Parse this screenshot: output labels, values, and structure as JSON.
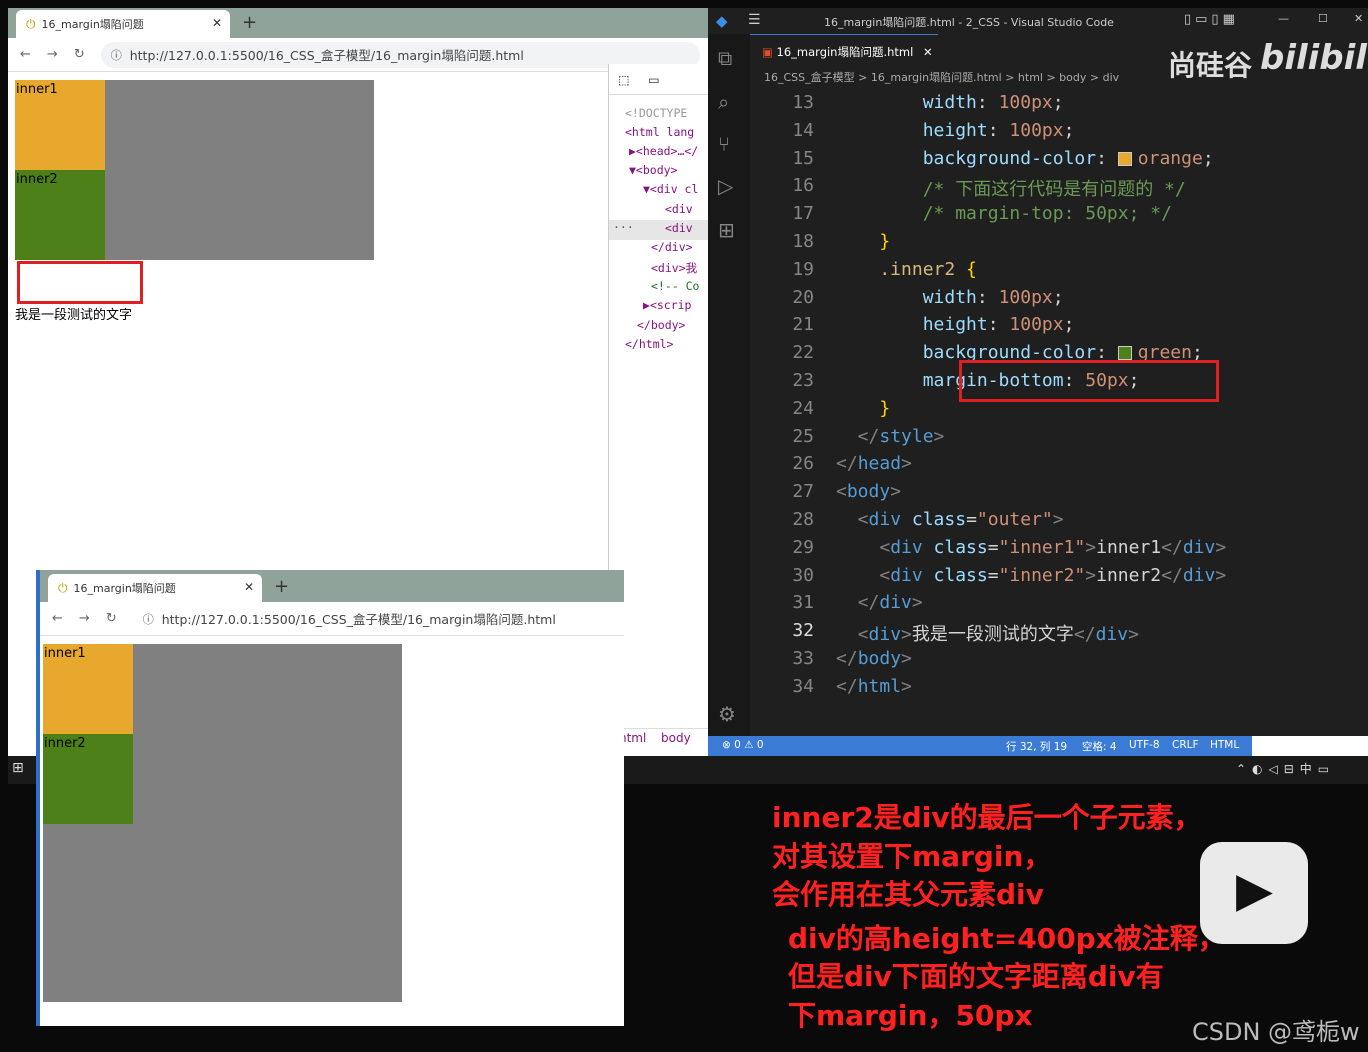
{
  "browser1": {
    "tab_title": "16_margin塌陷问题",
    "url": "http://127.0.0.1:5500/16_CSS_盒子模型/16_margin塌陷问题.html",
    "inner1": "inner1",
    "inner2": "inner2",
    "text": "我是一段测试的文字"
  },
  "devtools": {
    "lines": [
      "<!DOCTYPE",
      "<html lang",
      "▶<head>…</",
      "▼<body>",
      "▼<div cl",
      "<div",
      "<div",
      "</div>",
      "<div>我",
      "<!-- Co",
      "▶<scrip",
      "</body>",
      "</html>"
    ],
    "breadcrumb": [
      "html",
      "body"
    ]
  },
  "vscode": {
    "title": "16_margin塌陷问题.html - 2_CSS - Visual Studio Code",
    "tab": "16_margin塌陷问题.html",
    "breadcrumb": "16_CSS_盒子模型 > 16_margin塌陷问题.html > html > body > div",
    "watermark_text": "尚硅谷",
    "watermark_logo": "bilibili",
    "lines": [
      {
        "n": "13",
        "parts": [
          [
            "prop",
            "        width"
          ],
          [
            "txt",
            ": "
          ],
          [
            "val",
            "100px"
          ],
          [
            "txt",
            ";"
          ]
        ]
      },
      {
        "n": "14",
        "parts": [
          [
            "prop",
            "        height"
          ],
          [
            "txt",
            ": "
          ],
          [
            "val",
            "100px"
          ],
          [
            "txt",
            ";"
          ]
        ]
      },
      {
        "n": "15",
        "parts": [
          [
            "prop",
            "        background-color"
          ],
          [
            "txt",
            ": "
          ],
          [
            "sw",
            "orange"
          ],
          [
            "val",
            "orange"
          ],
          [
            "txt",
            ";"
          ]
        ]
      },
      {
        "n": "16",
        "parts": [
          [
            "cmt",
            "        /* 下面这行代码是有问题的 */"
          ]
        ]
      },
      {
        "n": "17",
        "parts": [
          [
            "cmt",
            "        /* margin-top: 50px; */"
          ]
        ]
      },
      {
        "n": "18",
        "parts": [
          [
            "br",
            "    }"
          ]
        ]
      },
      {
        "n": "19",
        "parts": [
          [
            "sel",
            "    .inner2 "
          ],
          [
            "br",
            "{"
          ]
        ]
      },
      {
        "n": "20",
        "parts": [
          [
            "prop",
            "        width"
          ],
          [
            "txt",
            ": "
          ],
          [
            "val",
            "100px"
          ],
          [
            "txt",
            ";"
          ]
        ]
      },
      {
        "n": "21",
        "parts": [
          [
            "prop",
            "        height"
          ],
          [
            "txt",
            ": "
          ],
          [
            "val",
            "100px"
          ],
          [
            "txt",
            ";"
          ]
        ]
      },
      {
        "n": "22",
        "parts": [
          [
            "prop",
            "        background-color"
          ],
          [
            "txt",
            ": "
          ],
          [
            "sw",
            "green"
          ],
          [
            "val",
            "green"
          ],
          [
            "txt",
            ";"
          ]
        ]
      },
      {
        "n": "23",
        "parts": [
          [
            "prop",
            "        margin-bottom"
          ],
          [
            "txt",
            ": "
          ],
          [
            "val",
            "50px"
          ],
          [
            "txt",
            ";"
          ]
        ]
      },
      {
        "n": "24",
        "parts": [
          [
            "br",
            "    }"
          ]
        ]
      },
      {
        "n": "25",
        "parts": [
          [
            "brk",
            "  </"
          ],
          [
            "tag",
            "style"
          ],
          [
            "brk",
            ">"
          ]
        ]
      },
      {
        "n": "26",
        "parts": [
          [
            "brk",
            "</"
          ],
          [
            "tag",
            "head"
          ],
          [
            "brk",
            ">"
          ]
        ]
      },
      {
        "n": "27",
        "parts": [
          [
            "brk",
            "<"
          ],
          [
            "tag",
            "body"
          ],
          [
            "brk",
            ">"
          ]
        ]
      },
      {
        "n": "28",
        "parts": [
          [
            "brk",
            "  <"
          ],
          [
            "tag",
            "div "
          ],
          [
            "attr",
            "class"
          ],
          [
            "txt",
            "="
          ],
          [
            "str",
            "\"outer\""
          ],
          [
            "brk",
            ">"
          ]
        ]
      },
      {
        "n": "29",
        "parts": [
          [
            "brk",
            "    <"
          ],
          [
            "tag",
            "div "
          ],
          [
            "attr",
            "class"
          ],
          [
            "txt",
            "="
          ],
          [
            "str",
            "\"inner1\""
          ],
          [
            "brk",
            ">"
          ],
          [
            "txt",
            "inner1"
          ],
          [
            "brk",
            "</"
          ],
          [
            "tag",
            "div"
          ],
          [
            "brk",
            ">"
          ]
        ]
      },
      {
        "n": "30",
        "parts": [
          [
            "brk",
            "    <"
          ],
          [
            "tag",
            "div "
          ],
          [
            "attr",
            "class"
          ],
          [
            "txt",
            "="
          ],
          [
            "str",
            "\"inner2\""
          ],
          [
            "brk",
            ">"
          ],
          [
            "txt",
            "inner2"
          ],
          [
            "brk",
            "</"
          ],
          [
            "tag",
            "div"
          ],
          [
            "brk",
            ">"
          ]
        ]
      },
      {
        "n": "31",
        "parts": [
          [
            "brk",
            "  </"
          ],
          [
            "tag",
            "div"
          ],
          [
            "brk",
            ">"
          ]
        ]
      },
      {
        "n": "32",
        "parts": [
          [
            "brk",
            "  <"
          ],
          [
            "tag",
            "div"
          ],
          [
            "brk",
            ">"
          ],
          [
            "txt",
            "我是一段测试的文字"
          ],
          [
            "brk",
            "</"
          ],
          [
            "tag",
            "div"
          ],
          [
            "brk",
            ">"
          ]
        ]
      },
      {
        "n": "33",
        "parts": [
          [
            "brk",
            "</"
          ],
          [
            "tag",
            "body"
          ],
          [
            "brk",
            ">"
          ]
        ]
      },
      {
        "n": "34",
        "parts": [
          [
            "brk",
            "</"
          ],
          [
            "tag",
            "html"
          ],
          [
            "brk",
            ">"
          ]
        ]
      }
    ],
    "status": {
      "errors": "⊗ 0 ⚠ 0",
      "position": "行 32, 列 19",
      "spaces": "空格: 4",
      "encoding": "UTF-8",
      "eol": "CRLF",
      "lang": "HTML"
    }
  },
  "browser2": {
    "tab_title": "16_margin塌陷问题",
    "url": "http://127.0.0.1:5500/16_CSS_盒子模型/16_margin塌陷问题.html",
    "inner1": "inner1",
    "inner2": "inner2"
  },
  "captions": [
    "inner2是div的最后一个子元素，",
    "对其设置下margin，",
    "会作用在其父元素div",
    "div的高height=400px被注释，",
    "但是div下面的文字距离div有",
    "下margin，50px"
  ],
  "watermark": "CSDN @鸢栀w",
  "colors": {
    "orange": "#e8a82e",
    "green": "#4d8018",
    "gray": "#808080",
    "highlight": "#e02020",
    "statusbar": "#3a7bd5"
  }
}
